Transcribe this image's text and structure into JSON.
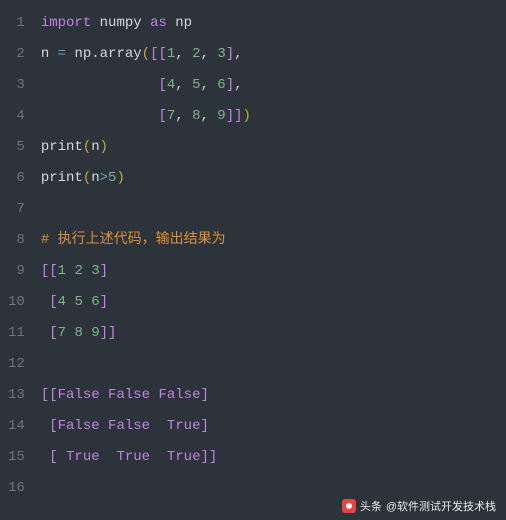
{
  "lines": [
    {
      "num": "1",
      "tokens": [
        [
          "kw",
          "import"
        ],
        [
          "plain",
          " "
        ],
        [
          "ident",
          "numpy"
        ],
        [
          "plain",
          " "
        ],
        [
          "kw",
          "as"
        ],
        [
          "plain",
          " "
        ],
        [
          "ident",
          "np"
        ]
      ]
    },
    {
      "num": "2",
      "tokens": [
        [
          "ident",
          "n"
        ],
        [
          "plain",
          " "
        ],
        [
          "op",
          "="
        ],
        [
          "plain",
          " "
        ],
        [
          "ident",
          "np"
        ],
        [
          "plain",
          "."
        ],
        [
          "ident",
          "array"
        ],
        [
          "paren",
          "("
        ],
        [
          "brk",
          "[["
        ],
        [
          "num",
          "1"
        ],
        [
          "plain",
          ", "
        ],
        [
          "num",
          "2"
        ],
        [
          "plain",
          ", "
        ],
        [
          "num",
          "3"
        ],
        [
          "brk",
          "]"
        ],
        [
          "plain",
          ","
        ]
      ]
    },
    {
      "num": "3",
      "tokens": [
        [
          "plain",
          "              "
        ],
        [
          "brk",
          "["
        ],
        [
          "num",
          "4"
        ],
        [
          "plain",
          ", "
        ],
        [
          "num",
          "5"
        ],
        [
          "plain",
          ", "
        ],
        [
          "num",
          "6"
        ],
        [
          "brk",
          "]"
        ],
        [
          "plain",
          ","
        ]
      ]
    },
    {
      "num": "4",
      "tokens": [
        [
          "plain",
          "              "
        ],
        [
          "brk",
          "["
        ],
        [
          "num",
          "7"
        ],
        [
          "plain",
          ", "
        ],
        [
          "num",
          "8"
        ],
        [
          "plain",
          ", "
        ],
        [
          "num",
          "9"
        ],
        [
          "brk",
          "]]"
        ],
        [
          "paren",
          ")"
        ]
      ]
    },
    {
      "num": "5",
      "tokens": [
        [
          "ident",
          "print"
        ],
        [
          "paren",
          "("
        ],
        [
          "ident",
          "n"
        ],
        [
          "paren",
          ")"
        ]
      ]
    },
    {
      "num": "6",
      "tokens": [
        [
          "ident",
          "print"
        ],
        [
          "paren",
          "("
        ],
        [
          "ident",
          "n"
        ],
        [
          "op",
          ">"
        ],
        [
          "num",
          "5"
        ],
        [
          "paren",
          ")"
        ]
      ]
    },
    {
      "num": "7",
      "tokens": []
    },
    {
      "num": "8",
      "tokens": [
        [
          "comment",
          "# 执行上述代码，输出结果为"
        ]
      ]
    },
    {
      "num": "9",
      "tokens": [
        [
          "brk",
          "[["
        ],
        [
          "num",
          "1"
        ],
        [
          "plain",
          " "
        ],
        [
          "num",
          "2"
        ],
        [
          "plain",
          " "
        ],
        [
          "num",
          "3"
        ],
        [
          "brk",
          "]"
        ]
      ]
    },
    {
      "num": "10",
      "tokens": [
        [
          "plain",
          " "
        ],
        [
          "brk",
          "["
        ],
        [
          "num",
          "4"
        ],
        [
          "plain",
          " "
        ],
        [
          "num",
          "5"
        ],
        [
          "plain",
          " "
        ],
        [
          "num",
          "6"
        ],
        [
          "brk",
          "]"
        ]
      ]
    },
    {
      "num": "11",
      "tokens": [
        [
          "plain",
          " "
        ],
        [
          "brk",
          "["
        ],
        [
          "num",
          "7"
        ],
        [
          "plain",
          " "
        ],
        [
          "num",
          "8"
        ],
        [
          "plain",
          " "
        ],
        [
          "num",
          "9"
        ],
        [
          "brk",
          "]]"
        ]
      ]
    },
    {
      "num": "12",
      "tokens": []
    },
    {
      "num": "13",
      "tokens": [
        [
          "brk",
          "[["
        ],
        [
          "bool",
          "False"
        ],
        [
          "plain",
          " "
        ],
        [
          "bool",
          "False"
        ],
        [
          "plain",
          " "
        ],
        [
          "bool",
          "False"
        ],
        [
          "brk",
          "]"
        ]
      ]
    },
    {
      "num": "14",
      "tokens": [
        [
          "plain",
          " "
        ],
        [
          "brk",
          "["
        ],
        [
          "bool",
          "False"
        ],
        [
          "plain",
          " "
        ],
        [
          "bool",
          "False"
        ],
        [
          "plain",
          "  "
        ],
        [
          "bool",
          "True"
        ],
        [
          "brk",
          "]"
        ]
      ]
    },
    {
      "num": "15",
      "tokens": [
        [
          "plain",
          " "
        ],
        [
          "brk",
          "["
        ],
        [
          "plain",
          " "
        ],
        [
          "bool",
          "True"
        ],
        [
          "plain",
          "  "
        ],
        [
          "bool",
          "True"
        ],
        [
          "plain",
          "  "
        ],
        [
          "bool",
          "True"
        ],
        [
          "brk",
          "]]"
        ]
      ]
    },
    {
      "num": "16",
      "tokens": []
    }
  ],
  "watermark": {
    "prefix": "头条",
    "handle": "@软件测试开发技术栈"
  }
}
